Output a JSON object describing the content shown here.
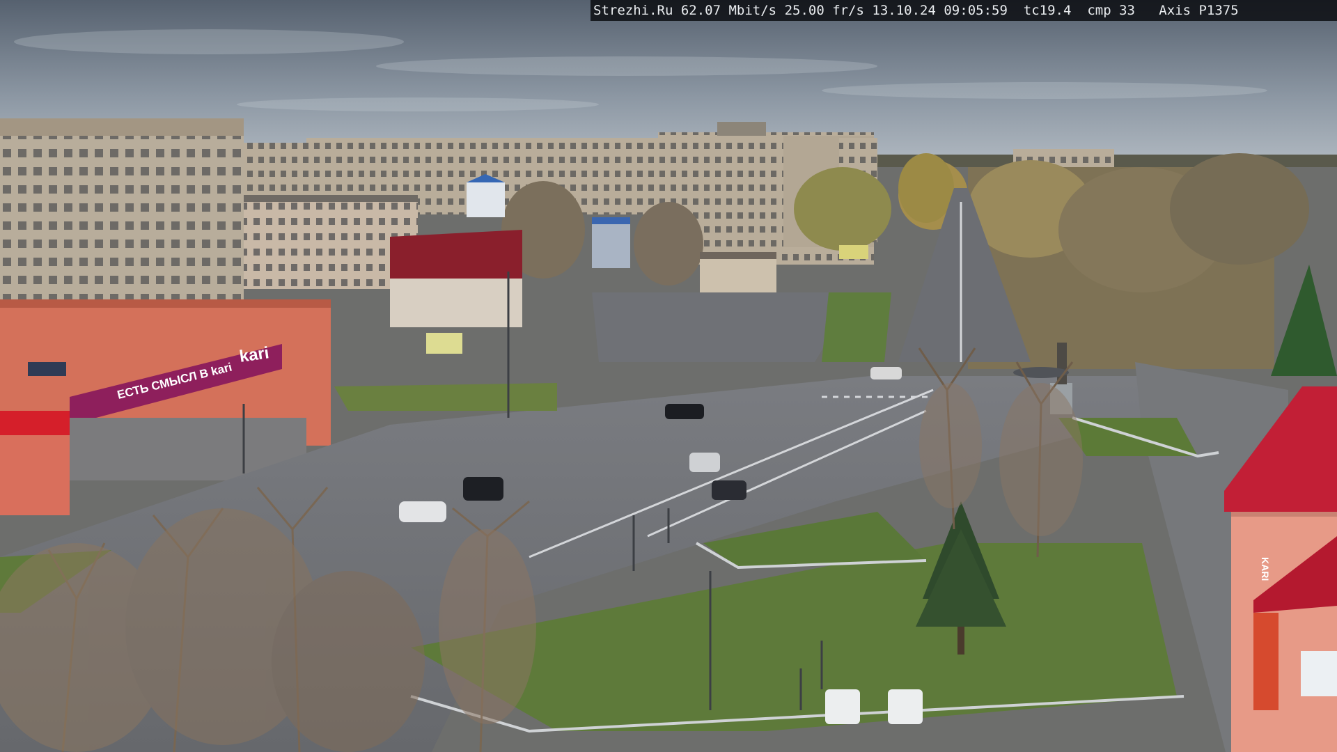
{
  "overlay": {
    "site": "Strezhi.Ru",
    "bitrate": "62.07 Mbit/s",
    "framerate": "25.00 fr/s",
    "datetime": "13.10.24 09:05:59",
    "tc": "tc19.4",
    "cmp": "cmp 33",
    "camera": "Axis P1375"
  },
  "signs": {
    "store_name": "kari",
    "store_slogan": "ЕСТЬ СМЫСЛ В kari",
    "brand_mark": "KARI"
  },
  "colors": {
    "sky_top": "#5f6a79",
    "sky_bottom": "#a9b2bb",
    "road": "#6f7176",
    "grass": "#5e7a3a",
    "store_facade": "#d4715a",
    "store_banner": "#8e1f5c",
    "tower_roof": "#c21f36"
  }
}
